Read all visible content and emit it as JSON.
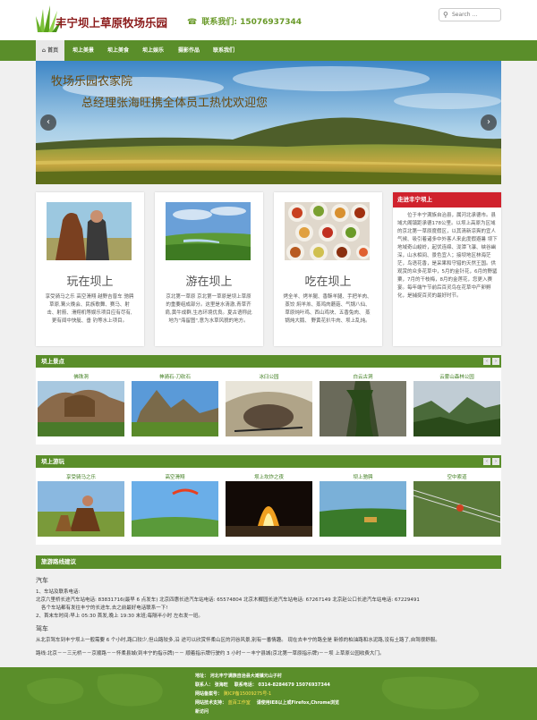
{
  "header": {
    "site_title": "丰宁坝上草原牧场乐园",
    "contact_label": "联系我们:",
    "contact_phone": "15076937344",
    "search_placeholder": "Search ..."
  },
  "nav": {
    "items": [
      {
        "label": "⌂ 首页",
        "active": true
      },
      {
        "label": "坝上美景"
      },
      {
        "label": "坝上美食"
      },
      {
        "label": "坝上娱乐"
      },
      {
        "label": "摄影作品"
      },
      {
        "label": "联系我们"
      }
    ]
  },
  "slider": {
    "title_line1": "牧场乐园农家院",
    "title_line2": "总经理张海旺携全体员工热忱欢迎您",
    "prev": "‹",
    "next": "›"
  },
  "features": [
    {
      "title": "玩在坝上",
      "text": "享受骑马之乐 高空滑翔 越野吉普车 驰骋草原,篝火晚会、民族歌舞、赛马、射击、射箭、滑翔机等娱乐项目应有尽有,更有闻中快艇、垂 钓等水上项目。"
    },
    {
      "title": "游在坝上",
      "text": "京北第一草原 京北第一草原是坝上草原的重要组成部分。这里是水清澈,青草齐肩,黄牛成群,生态环境优良。夏古语称此地为\"海留图\",意为水草风貌的地方。"
    },
    {
      "title": "吃在坝上",
      "text": "烤全羊、烤羊腿、香酥羊腿、手把羊肉、蒸饺 焖羊羔、蒸鸡肉蘑菇、气锅八仙、草原炖叶鸡、西山鸡块、五香兔肉、 蒸锅炖大鹅、 野黄花扒牛肉、坝上乱炖。"
    }
  ],
  "about": {
    "heading": "走进丰宁坝上",
    "text": "位于丰宁满族自治县，属河北承德市。县域大阁镇距承德178公里。以坝上高原为区域的京北第一草原度假区，以其清新凉爽的宜人气候、吸引着诸多中外客人来此度假避暑 坝下地域奇山峻岭，起伏连绵、泷潭飞瀑、峡谷幽深，山水相间、景色宜人；接坝地区林海茫茫，鸟语花香，是采果和守猎的天然王国。供观赏的众多花草中，5月的金针花，6月的野罂粟，7月的干枝梅，8月的金莲花，您更入赛宴。每年端午节前后百灵鸟在花草中产卵孵化，是捕捉百灵的最好时节。"
  },
  "scenery": {
    "heading": "坝上景点",
    "items": [
      "佛珠洞",
      "神骑石-刀砍石",
      "冰臼公园",
      "白云古洞",
      "云雾山森林公园"
    ]
  },
  "fun": {
    "heading": "坝上游玩",
    "items": [
      "享受骑马之乐",
      "高空滑翔",
      "坝上坎炸之夜",
      "坝上驰骋",
      "空中索道"
    ]
  },
  "route": {
    "heading": "旅游路线建议",
    "car_heading": "汽车",
    "car_lines": [
      "1、车站及联系电话:",
      "北京六里桥长途汽车站电话: 83831716(最早 6 点发车) 北京四惠长途汽车站电话: 65574804 北京木樨园长途汽车站电话: 67267149 北京赵公口长途汽车站电话: 67229491",
      "各个车站都有发往丰宁的长途车,去之前最好电话联系一下!",
      "2、首末车时间:早上 05:30 首发,晚上 19:30 末班;每隔半小时 左右发一班。"
    ],
    "drive_heading": "驾车",
    "drive_lines": [
      "从北京驾车到丰宁坝上一般需要 6 个小时,路口较少,但山路较多,沿 途可以欣赏怀柔山区的河谷风景,别有一番情趣。 现在去丰宁的路全是 新修的柏油路和水泥路,没有土路了,自驾很舒服。",
      "路线:北京－－三元桥－－京顺路－－怀柔县城(到丰宁的指示牌)－－ 顺着指示牌行驶约 3 小时－－丰宁县城(京北第一草原指示牌)－－坝 上草原公园收费大门。"
    ]
  },
  "footer": {
    "address": "地址： 河北丰宁满族自治县大滩镇元山子村",
    "contact_person": "联系人： 张海旺",
    "contact_tel": "联系电话： 0314-8284679   15076937344",
    "icp_label": "网站备案号：",
    "icp_value": "冀ICP备15009275号-1",
    "tech_label": "网站技术支持：",
    "tech_value": "蓝百工作室",
    "browser_tip": "请使用IE8以上或Firefox,Chrome浏览",
    "visits": "新访问"
  },
  "colors": {
    "green": "#5a8e2a",
    "red": "#d0222d",
    "title_red": "#8b1a1a"
  }
}
